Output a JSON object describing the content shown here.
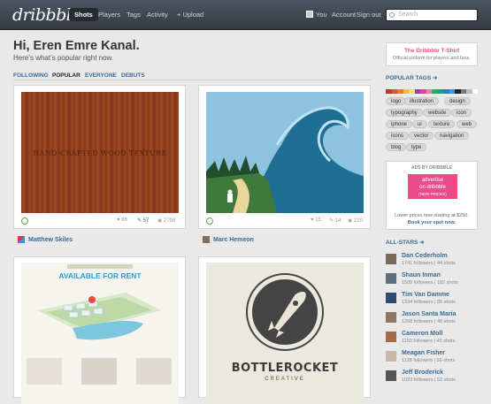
{
  "nav": {
    "logo": "dribbble",
    "items": [
      "Shots",
      "Players",
      "Tags",
      "Activity",
      "+ Upload"
    ],
    "user": "You",
    "account": "Account",
    "signout": "Sign out",
    "search_placeholder": "Search"
  },
  "greeting": "Hi, Eren Emre Kanal.",
  "subtitle": "Here’s what’s popular right now.",
  "tabs": [
    "FOLLOWING",
    "POPULAR",
    "EVERYONE",
    "DEBUTS"
  ],
  "shots": [
    {
      "title": "HAND-CRAFTED WOOD TEXTURE",
      "likes": "86",
      "comments": "57",
      "views": "2798",
      "author": "Matthew Skiles"
    },
    {
      "likes": "15",
      "comments": "14",
      "views": "220",
      "author": "Marc Hemeon"
    },
    {
      "title": "AVAILABLE FOR RENT"
    },
    {
      "title": "BOTTLEROCKET",
      "subtitle": "CREATIVE"
    }
  ],
  "promo": {
    "title": "The Dribbble T-Shirt",
    "text": "Official uniform for players and fans."
  },
  "tags_title": "POPULAR TAGS ➔",
  "tags": [
    "logo",
    "illustration",
    "design",
    "typography",
    "website",
    "icon",
    "iphone",
    "ui",
    "texture",
    "web",
    "icons",
    "vector",
    "navigation",
    "blog",
    "type"
  ],
  "ad": {
    "label": "ADS BY DRIBBBLE",
    "line1": "advertise",
    "line2": "on dribbble",
    "line3": "(NEW PRICES)",
    "text1": "Lower prices now starting at $250.",
    "text2": "Book your spot now."
  },
  "allstars_title": "ALL-STARS ➔",
  "players": [
    {
      "name": "Dan Cederholm",
      "stats": "1741 followers  |  44 shots"
    },
    {
      "name": "Shaun Inman",
      "stats": "1505 followers  |  182 shots"
    },
    {
      "name": "Tim Van Damme",
      "stats": "1334 followers  |  85 shots"
    },
    {
      "name": "Jason Santa Maria",
      "stats": "1268 followers  |  48 shots"
    },
    {
      "name": "Cameron Moll",
      "stats": "1153 followers  |  45 shots"
    },
    {
      "name": "Meagan Fisher",
      "stats": "1128 followers  |  56 shots"
    },
    {
      "name": "Jeff Broderick",
      "stats": "1023 followers  |  53 shots"
    }
  ]
}
